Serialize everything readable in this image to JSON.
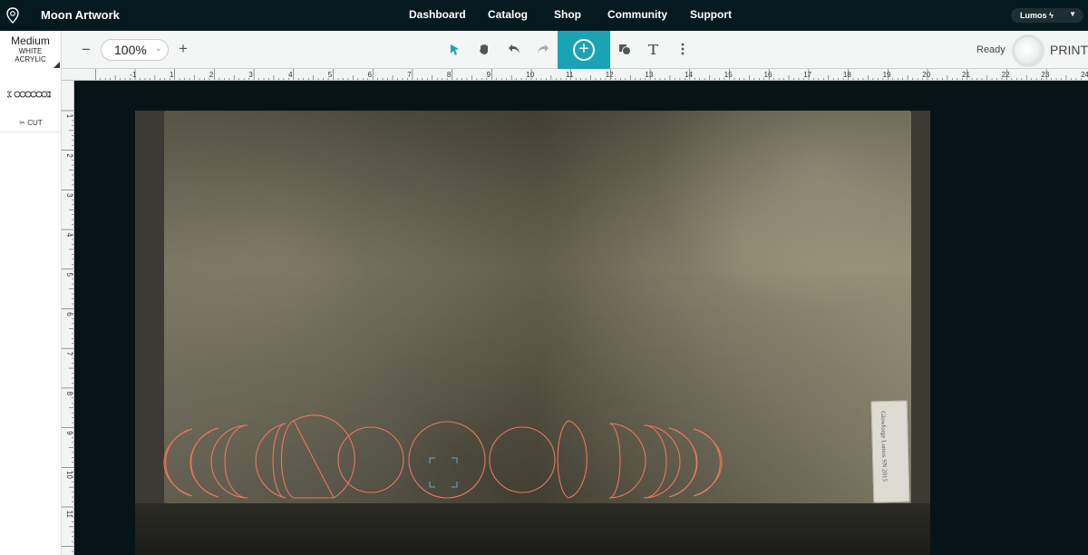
{
  "app": {
    "title": "Moon Artwork"
  },
  "nav": {
    "links": [
      "Dashboard",
      "Catalog",
      "Shop",
      "Community",
      "Support"
    ],
    "user": "Lumos",
    "user_icon": "lightning-icon"
  },
  "material": {
    "thickness": "Medium",
    "color": "WHITE",
    "type": "ACRYLIC"
  },
  "toolbar": {
    "zoom": "100%",
    "zoom_out": "−",
    "zoom_in": "+",
    "status": "Ready",
    "print": "PRINT",
    "icons": [
      "pointer-icon",
      "hand-icon",
      "undo-icon",
      "redo-icon",
      "add-icon",
      "shapes-icon",
      "text-icon",
      "more-icon"
    ],
    "accent": "#1aa3b3"
  },
  "panel": {
    "operation": "CUT"
  },
  "rulers": {
    "x_labels": [
      "-1",
      "1",
      "2",
      "3",
      "4",
      "5",
      "6",
      "7",
      "8",
      "9",
      "10",
      "11",
      "12",
      "13",
      "14",
      "15",
      "16",
      "17",
      "18",
      "19",
      "20",
      "21",
      "22",
      "23",
      "24"
    ],
    "y_labels": [
      "1",
      "2",
      "3",
      "4",
      "5",
      "6",
      "7",
      "8",
      "9",
      "10",
      "11"
    ],
    "units": "in"
  },
  "design": {
    "cut_color": "#e8775d",
    "shapes": 13
  },
  "sticker": {
    "text": "Glowforge Lumos SN 2015"
  }
}
